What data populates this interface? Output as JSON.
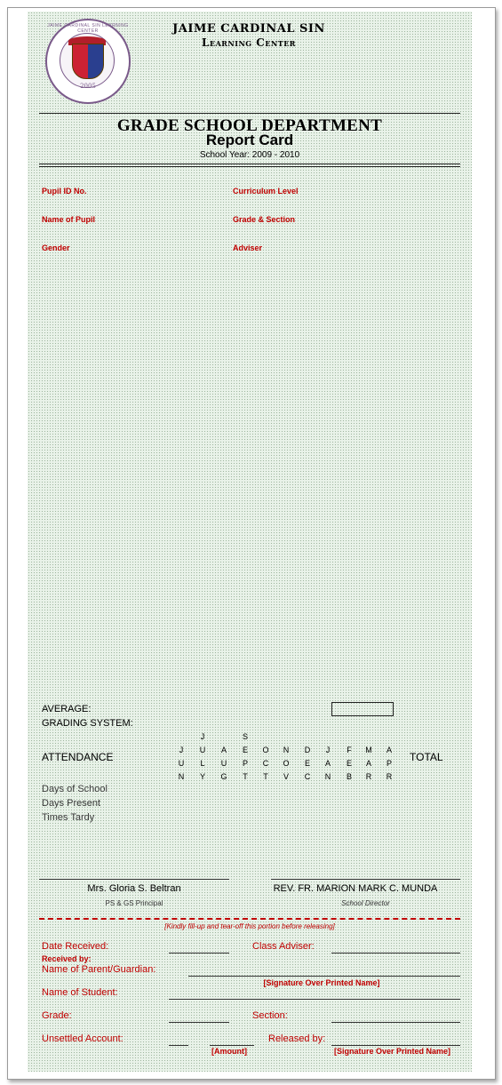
{
  "school": {
    "name_line1": "JAIME CARDINAL SIN",
    "name_line2": "Learning Center",
    "seal_year": "2005",
    "seal_ring_text": "JAIME CARDINAL SIN LEARNING CENTER"
  },
  "department": "GRADE SCHOOL DEPARTMENT",
  "doc_title": "Report Card",
  "school_year": "School Year:  2009 - 2010",
  "fields": {
    "pupil_id": "Pupil ID No.",
    "curriculum": "Curriculum Level",
    "name": "Name of Pupil",
    "grade_section": "Grade & Section",
    "gender": "Gender",
    "adviser": "Adviser"
  },
  "average_label": "AVERAGE:",
  "grading_label": "GRADING SYSTEM:",
  "attendance": {
    "label": "ATTENDANCE",
    "total_label": "TOTAL",
    "months": [
      [
        "",
        "J",
        "U",
        "N"
      ],
      [
        "J",
        "U",
        "L",
        "Y"
      ],
      [
        "",
        "A",
        "U",
        "G"
      ],
      [
        "S",
        "E",
        "P",
        "T"
      ],
      [
        "",
        "O",
        "C",
        "T"
      ],
      [
        "",
        "N",
        "O",
        "V"
      ],
      [
        "",
        "D",
        "E",
        "C"
      ],
      [
        "",
        "J",
        "A",
        "N"
      ],
      [
        "",
        "F",
        "E",
        "B"
      ],
      [
        "",
        "M",
        "A",
        "R"
      ],
      [
        "",
        "A",
        "P",
        "R"
      ]
    ],
    "rows": [
      "Days of School",
      "Days Present",
      "Times Tardy"
    ]
  },
  "signatories": {
    "principal_name": "Mrs. Gloria S. Beltran",
    "principal_title": "PS & GS Principal",
    "director_name": "REV. FR. MARION MARK C. MUNDA",
    "director_title": "School Director"
  },
  "tearoff": {
    "note": "[Kindly fill-up and tear-off this portion before releasing]",
    "date_received": "Date Received:",
    "class_adviser": "Class Adviser:",
    "received_by": "Received by:",
    "parent": "Name of Parent/Guardian:",
    "signature_note": "[Signature Over Printed Name]",
    "student": "Name of Student:",
    "grade": "Grade:",
    "section": "Section:",
    "unsettled": "Unsettled Account:",
    "released_by": "Released by:",
    "amount_note": "[Amount]",
    "signature_note2": "[Signature Over Printed Name]"
  }
}
